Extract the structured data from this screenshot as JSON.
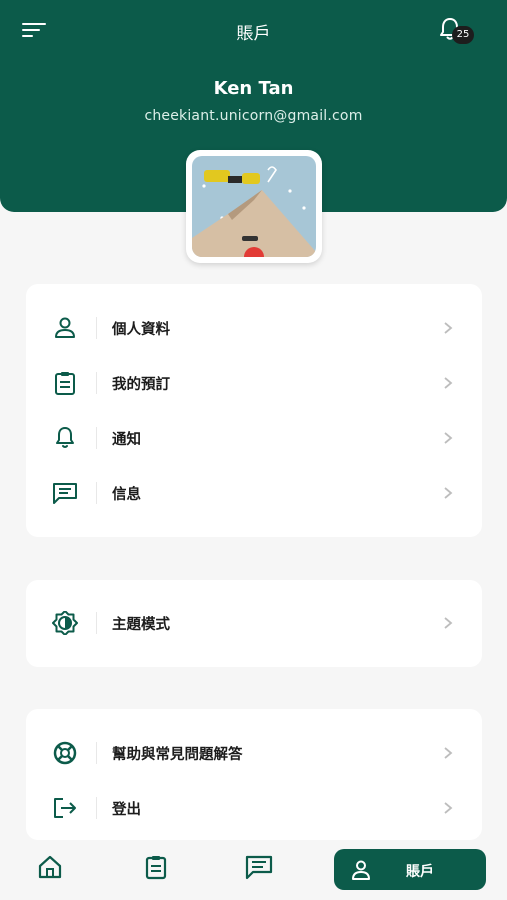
{
  "header": {
    "title": "賬戶",
    "notification_count": "25",
    "user_name": "Ken Tan",
    "user_email": "cheekiant.unicorn@gmail.com"
  },
  "menu_group_1": [
    {
      "label": "個人資料",
      "icon": "person-icon"
    },
    {
      "label": "我的預訂",
      "icon": "clipboard-icon"
    },
    {
      "label": "通知",
      "icon": "bell-icon"
    },
    {
      "label": "信息",
      "icon": "message-icon"
    }
  ],
  "menu_group_2": [
    {
      "label": "主題模式",
      "icon": "brightness-icon"
    }
  ],
  "menu_group_3": [
    {
      "label": "幫助與常見問題解答",
      "icon": "lifebuoy-icon"
    },
    {
      "label": "登出",
      "icon": "logout-icon"
    }
  ],
  "bottom_nav": {
    "items": [
      "home-icon",
      "clipboard-icon",
      "message-icon"
    ],
    "active_label": "賬戶",
    "active_icon": "person-icon"
  },
  "colors": {
    "brand": "#0c5b4a",
    "background": "#f6f6f6",
    "card": "#ffffff"
  }
}
